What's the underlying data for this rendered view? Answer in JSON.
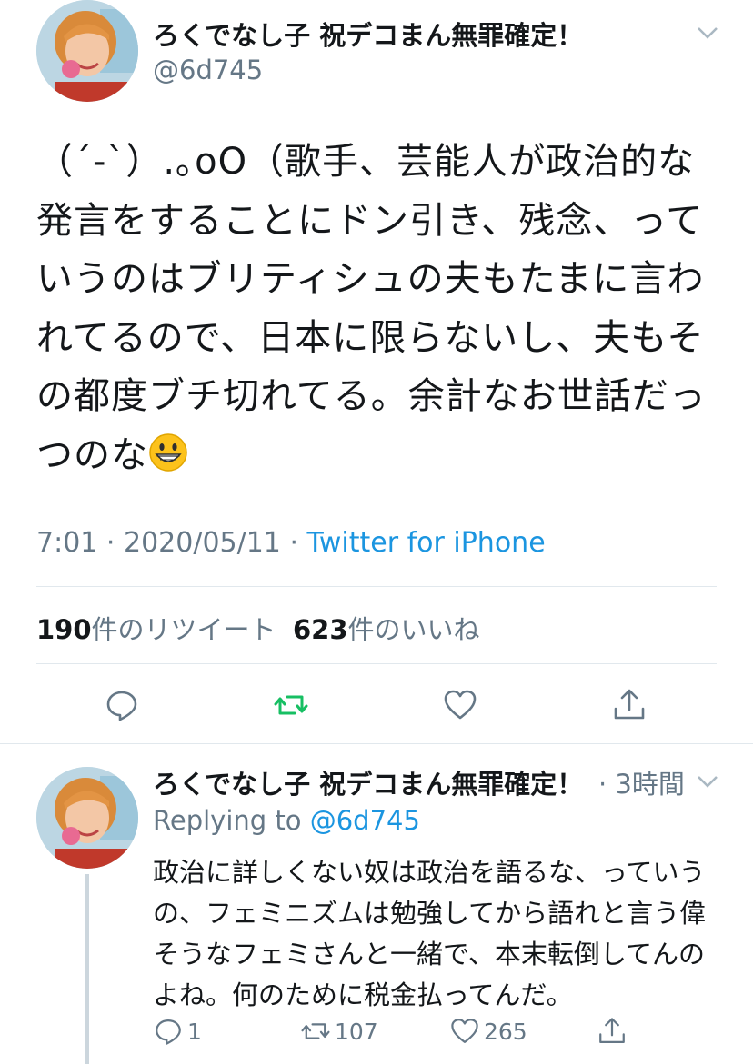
{
  "tweet": {
    "display_name": "ろくでなし子 祝デコまん無罪確定！",
    "handle": "@6d745",
    "text": "（´-`）.｡oO（歌手、芸能人が政治的な発言をすることにドン引き、残念、っていうのはブリティシュの夫もたまに言われてるので、日本に限らないし、夫もその都度ブチ切れてる。余計なお世話だっつのな",
    "emoji": "grinning-face-emoji",
    "time": "7:01",
    "date": "2020/05/11",
    "source": "Twitter for iPhone",
    "retweet_count": "190",
    "retweet_label": "件のリツイート",
    "like_count": "623",
    "like_label": "件のいいね",
    "icons": [
      "chevron-down-icon",
      "reply-icon",
      "retweet-icon",
      "like-icon",
      "share-icon"
    ],
    "retweet_color": "#17bf63"
  },
  "reply": {
    "display_name": "ろくでなし子 祝デコまん無罪確定！",
    "time": "· 3時間",
    "replying_to_label": "Replying to",
    "replying_to_handle": "@6d745",
    "text": "政治に詳しくない奴は政治を語るな、っていうの、フェミニズムは勉強してから語れと言う偉そうなフェミさんと一緒で、本末転倒してんのよね。何のために税金払ってんだ。",
    "reply_count": "1",
    "retweet_count": "107",
    "like_count": "265"
  },
  "colors": {
    "text": "#14171a",
    "secondary": "#657786",
    "link": "#1b95e0",
    "divider": "#e1e8ed"
  }
}
